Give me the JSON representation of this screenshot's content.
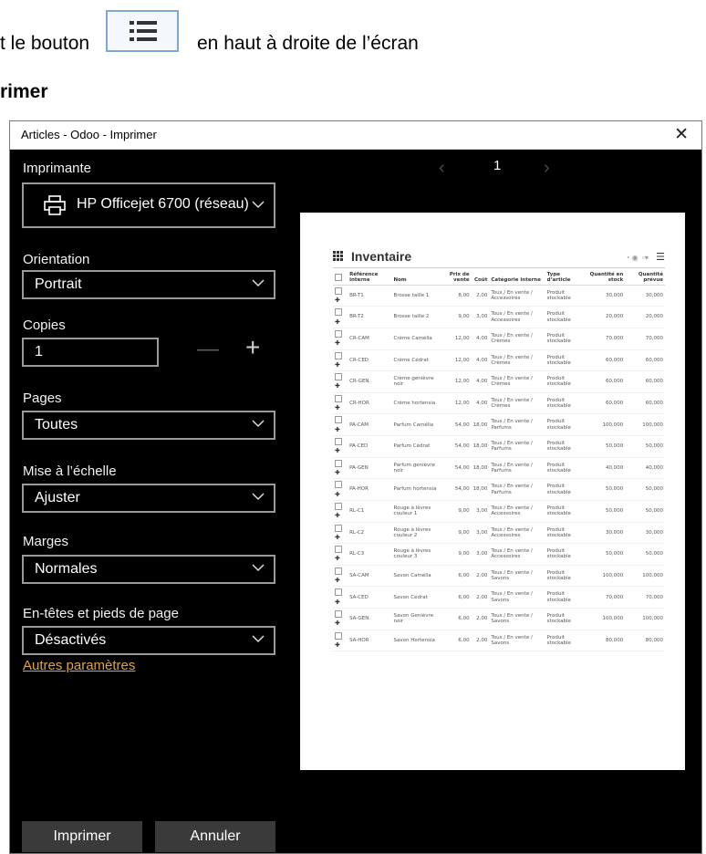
{
  "instructions": {
    "line1_prefix": "t le bouton",
    "line1_suffix": "en haut à droite de l’écran",
    "line2": "rimer"
  },
  "dialog": {
    "title": "Articles - Odoo - Imprimer",
    "close": "✕",
    "printer": {
      "label": "Imprimante",
      "value": "HP Officejet 6700 (réseau)"
    },
    "orientation": {
      "label": "Orientation",
      "value": "Portrait"
    },
    "copies": {
      "label": "Copies",
      "value": "1",
      "minus": "—",
      "plus": "+"
    },
    "pages": {
      "label": "Pages",
      "value": "Toutes"
    },
    "scale": {
      "label": "Mise à l’échelle",
      "value": "Ajuster"
    },
    "margins": {
      "label": "Marges",
      "value": "Normales"
    },
    "headers": {
      "label": "En-têtes et pieds de page",
      "value": "Désactivés"
    },
    "more_settings": "Autres paramètres",
    "print_button": "Imprimer",
    "cancel_button": "Annuler"
  },
  "preview": {
    "page_number": "1",
    "prev": "‹",
    "next": "›",
    "sheet_title": "Inventaire",
    "columns": [
      "Référence interne",
      "Nom",
      "Prix de vente",
      "Coût",
      "Catégorie interne",
      "Type d’article",
      "Quantité en stock",
      "Quantité prévue"
    ],
    "rows": [
      [
        "BR-T1",
        "Brosse taille 1",
        "8,00",
        "2,00",
        "Tous / En vente / Accessoires",
        "Produit stockable",
        "30,000",
        "30,000"
      ],
      [
        "BR-T2",
        "Brosse taille 2",
        "9,00",
        "3,00",
        "Tous / En vente / Accessoires",
        "Produit stockable",
        "20,000",
        "20,000"
      ],
      [
        "CR-CAM",
        "Crème Camélia",
        "12,00",
        "4,00",
        "Tous / En vente / Crèmes",
        "Produit stockable",
        "70,000",
        "70,000"
      ],
      [
        "CR-CED",
        "Crème Cédrat",
        "12,00",
        "4,00",
        "Tous / En vente / Crèmes",
        "Produit stockable",
        "60,000",
        "60,000"
      ],
      [
        "CR-GEN",
        "Crème genièvre noir",
        "12,00",
        "4,00",
        "Tous / En vente / Crèmes",
        "Produit stockable",
        "60,000",
        "60,000"
      ],
      [
        "CR-HOR",
        "Crème hortensia",
        "12,00",
        "4,00",
        "Tous / En vente / Crèmes",
        "Produit stockable",
        "60,000",
        "60,000"
      ],
      [
        "PA-CAM",
        "Parfum Camélia",
        "54,00",
        "18,00",
        "Tous / En vente / Parfums",
        "Produit stockable",
        "100,000",
        "100,000"
      ],
      [
        "PA-CED",
        "Parfum Cédrat",
        "54,00",
        "18,00",
        "Tous / En vente / Parfums",
        "Produit stockable",
        "50,000",
        "50,000"
      ],
      [
        "PA-GEN",
        "Parfum genièvre noir",
        "54,00",
        "18,00",
        "Tous / En vente / Parfums",
        "Produit stockable",
        "40,000",
        "40,000"
      ],
      [
        "PA-HOR",
        "Parfum hortensia",
        "54,00",
        "18,00",
        "Tous / En vente / Parfums",
        "Produit stockable",
        "50,000",
        "50,000"
      ],
      [
        "RL-C1",
        "Rouge à lèvres couleur 1",
        "9,00",
        "3,00",
        "Tous / En vente / Accessoires",
        "Produit stockable",
        "50,000",
        "50,000"
      ],
      [
        "RL-C2",
        "Rouge à lèvres couleur 2",
        "9,00",
        "3,00",
        "Tous / En vente / Accessoires",
        "Produit stockable",
        "30,000",
        "30,000"
      ],
      [
        "RL-C3",
        "Rouge à lèvres couleur 3",
        "9,00",
        "3,00",
        "Tous / En vente / Accessoires",
        "Produit stockable",
        "50,000",
        "50,000"
      ],
      [
        "SA-CAM",
        "Savon Camélia",
        "6,00",
        "2,00",
        "Tous / En vente / Savons",
        "Produit stockable",
        "100,000",
        "100,000"
      ],
      [
        "SA-CED",
        "Savon Cédrat",
        "6,00",
        "2,00",
        "Tous / En vente / Savons",
        "Produit stockable",
        "70,000",
        "70,000"
      ],
      [
        "SA-GEN",
        "Savon Genièvre noir",
        "6,00",
        "2,00",
        "Tous / En vente / Savons",
        "Produit stockable",
        "100,000",
        "100,000"
      ],
      [
        "SA-HOR",
        "Savon Hortensia",
        "6,00",
        "2,00",
        "Tous / En vente / Savons",
        "Produit stockable",
        "80,000",
        "80,000"
      ]
    ]
  }
}
